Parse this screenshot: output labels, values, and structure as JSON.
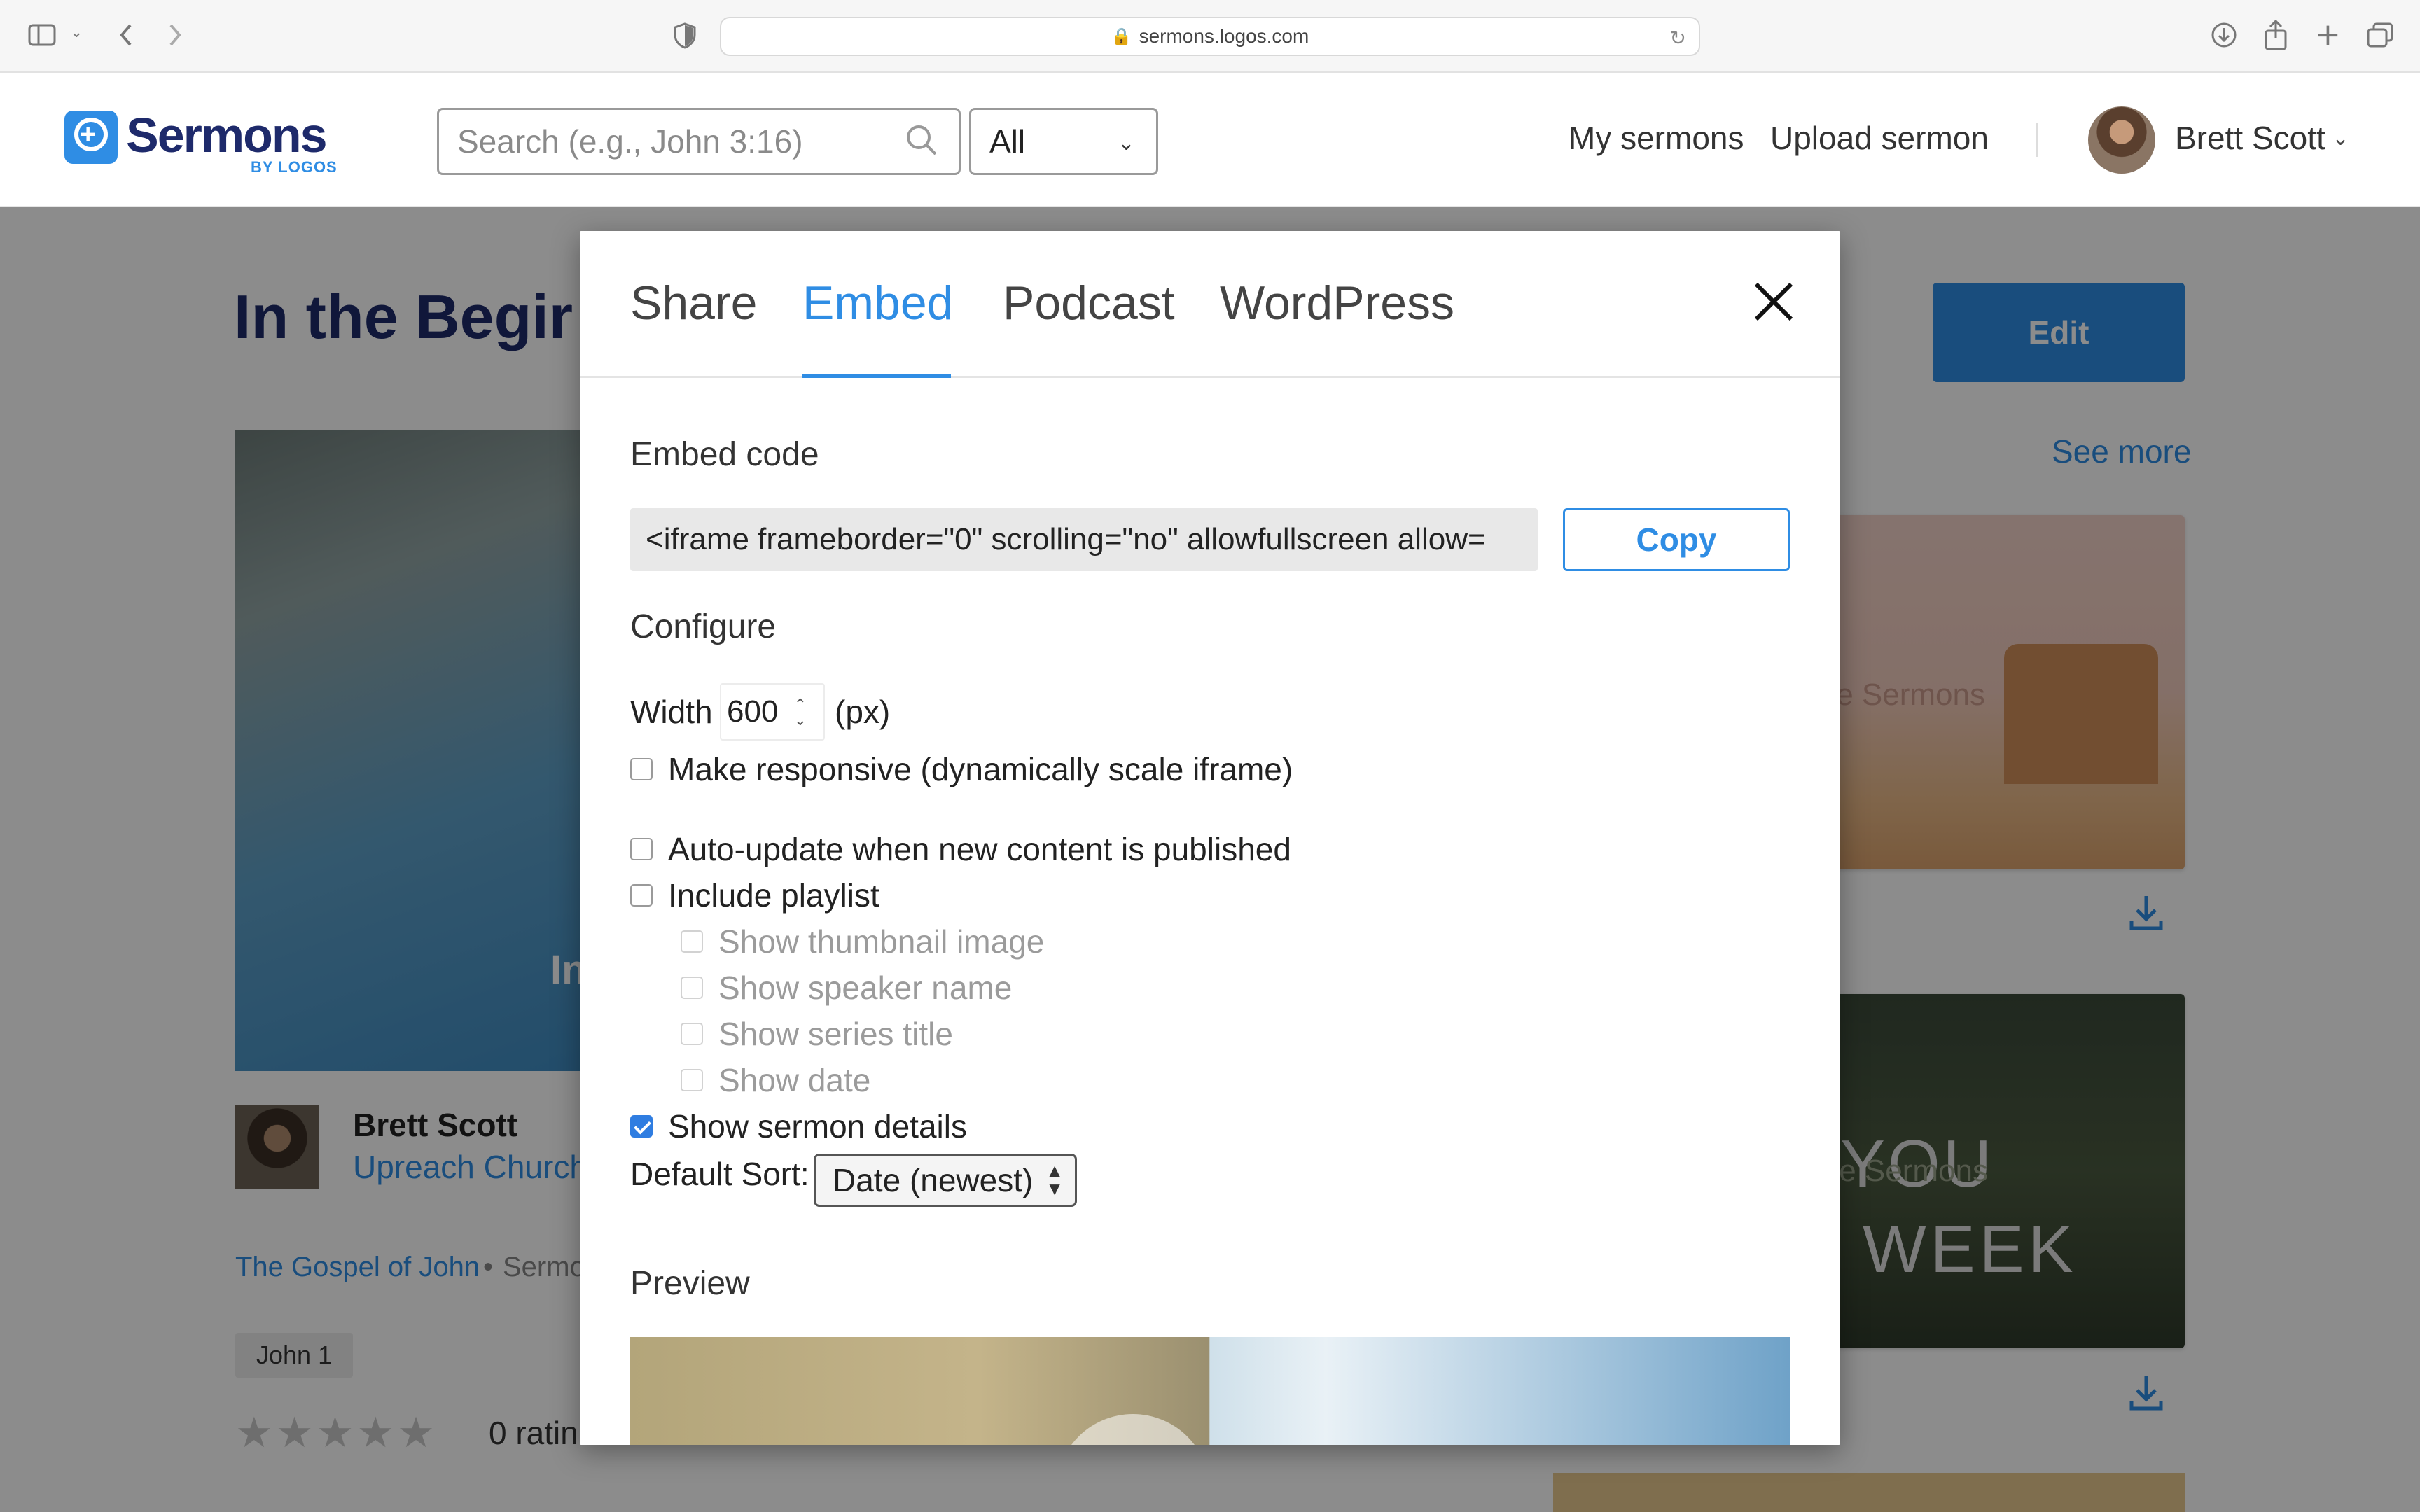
{
  "browser": {
    "url": "sermons.logos.com",
    "icons": [
      "sidebar-icon",
      "chevron-down-icon",
      "back-icon",
      "forward-icon",
      "privacy-shield-icon",
      "lock-icon",
      "reload-icon",
      "download-icon",
      "share-icon",
      "new-tab-icon",
      "tab-overview-icon"
    ]
  },
  "header": {
    "logo_title": "Sermons",
    "logo_subtitle": "BY LOGOS",
    "search_placeholder": "Search (e.g., John 3:16)",
    "filter_selected": "All",
    "nav": [
      "My sermons",
      "Upload sermon"
    ],
    "user_name": "Brett Scott"
  },
  "page": {
    "title": "In the Begir",
    "edit_label": "Edit",
    "see_more_label": "See more",
    "video_caption": "In",
    "speaker_name": "Brett Scott",
    "church_name": "Upreach Church",
    "series_name": "The Gospel of John",
    "series_separator": "•",
    "series_type": "Sermo",
    "scripture_tag": "John 1",
    "rating_stars": "★★★★★",
    "rating_count": "0 ratin",
    "related": [
      {
        "label": "fe Sermons"
      },
      {
        "label": "fe Sermons",
        "text_top": "YOU",
        "text_bottom": "WEEK"
      }
    ]
  },
  "modal": {
    "tabs": [
      "Share",
      "Embed",
      "Podcast",
      "WordPress"
    ],
    "active_tab": "Embed",
    "embed_code_label": "Embed code",
    "embed_code": "<iframe frameborder=\"0\" scrolling=\"no\" allowfullscreen allow=",
    "copy_label": "Copy",
    "configure_label": "Configure",
    "width_label": "Width",
    "width_value": "600",
    "width_unit": "(px)",
    "options": [
      {
        "label": "Make responsive (dynamically scale iframe)",
        "checked": false,
        "disabled": false
      },
      {
        "label": "Auto-update when new content is published",
        "checked": false,
        "disabled": false
      },
      {
        "label": "Include playlist",
        "checked": false,
        "disabled": false
      },
      {
        "label": "Show thumbnail image",
        "checked": false,
        "disabled": true
      },
      {
        "label": "Show speaker name",
        "checked": false,
        "disabled": true
      },
      {
        "label": "Show series title",
        "checked": false,
        "disabled": true
      },
      {
        "label": "Show date",
        "checked": false,
        "disabled": true
      },
      {
        "label": "Show sermon details",
        "checked": true,
        "disabled": false
      }
    ],
    "default_sort_label": "Default Sort:",
    "default_sort_value": "Date (newest)",
    "preview_label": "Preview"
  },
  "colors": {
    "accent": "#2f8de4",
    "brand_navy": "#1e2a6b",
    "checkbox_checked": "#2f7de1"
  }
}
